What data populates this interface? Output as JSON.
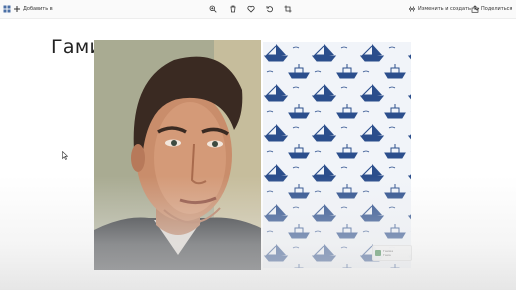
{
  "toolbar": {
    "menu_icon": "grid-icon",
    "add_label": "Добавить в",
    "edit_label": "Изменить и создать",
    "share_label": "Поделиться"
  },
  "slide": {
    "title": "Гами"
  },
  "badge": {
    "line1": "Гамма",
    "line2": "Гама"
  },
  "colors": {
    "accent": "#2b4e8c",
    "toolbar_bg": "#fafafa"
  }
}
